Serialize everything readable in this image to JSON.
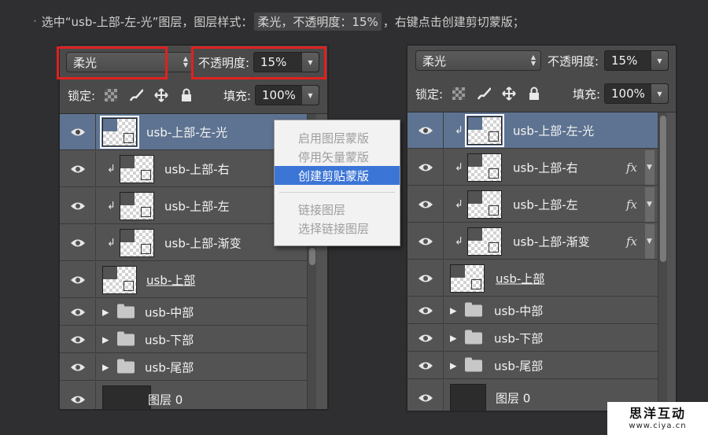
{
  "instruction": {
    "bullet": "·",
    "part1": "选中“usb-上部-左-光”图层，图层样式：",
    "code1": "柔光，不透明度：15%",
    "part2": "，右键点击创建剪切蒙版；"
  },
  "left_panel": {
    "blend_mode": "柔光",
    "opacity_label": "不透明度:",
    "opacity_value": "15%",
    "lock_label": "锁定:",
    "fill_label": "填充:",
    "fill_value": "100%",
    "layers": [
      {
        "name": "usb-上部-左-光",
        "selected": true
      },
      {
        "name": "usb-上部-右",
        "clipped": true
      },
      {
        "name": "usb-上部-左",
        "clipped": true
      },
      {
        "name": "usb-上部-渐变",
        "clipped": true
      },
      {
        "name": "usb-上部"
      },
      {
        "name": "usb-中部",
        "group": true
      },
      {
        "name": "usb-下部",
        "group": true
      },
      {
        "name": "usb-尾部",
        "group": true
      },
      {
        "name": "图层 0"
      }
    ]
  },
  "context_menu": {
    "items": [
      "启用图层蒙版",
      "停用矢量蒙版",
      "创建剪贴蒙版",
      "链接图层",
      "选择链接图层"
    ],
    "highlighted": "创建剪贴蒙版"
  },
  "right_panel": {
    "blend_mode": "柔光",
    "opacity_label": "不透明度:",
    "opacity_value": "15%",
    "lock_label": "锁定:",
    "fill_label": "填充:",
    "fill_value": "100%",
    "layers": [
      {
        "name": "usb-上部-左-光",
        "selected": true,
        "clipped": true
      },
      {
        "name": "usb-上部-右",
        "clipped": true,
        "fx": "fx"
      },
      {
        "name": "usb-上部-左",
        "clipped": true,
        "fx": "fx"
      },
      {
        "name": "usb-上部-渐变",
        "clipped": true,
        "fx": "fx"
      },
      {
        "name": "usb-上部"
      },
      {
        "name": "usb-中部",
        "group": true
      },
      {
        "name": "usb-下部",
        "group": true
      },
      {
        "name": "usb-尾部",
        "group": true
      },
      {
        "name": "图层 0"
      }
    ]
  },
  "icons": {
    "eye": "eye-icon",
    "clip_arrow": "↲",
    "group_triangle": "▶",
    "folder": "folder-icon"
  },
  "watermark": {
    "title": "思洋互动",
    "url": "www.ciya.cn"
  },
  "colors": {
    "background": "#2f2f31",
    "panel": "#4a4a4a",
    "selected_row": "#5e7391",
    "highlight": "#3b75d6",
    "annotation": "#e02020"
  }
}
